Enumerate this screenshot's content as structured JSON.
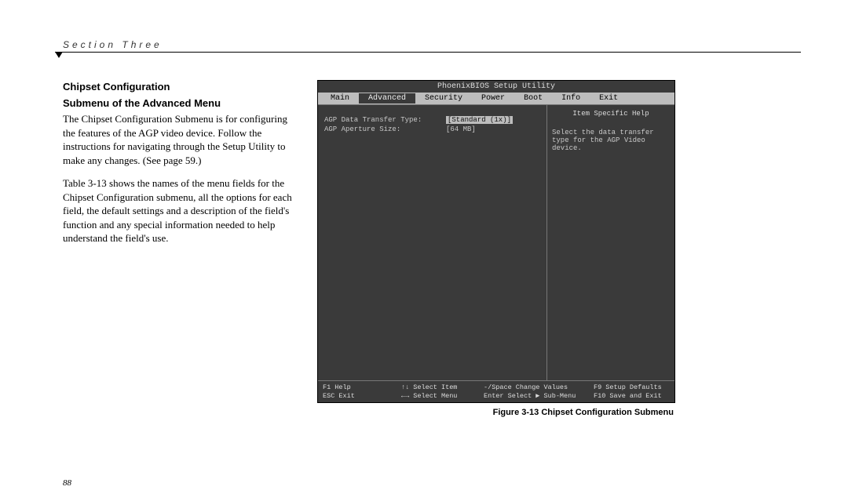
{
  "header": {
    "section": "Section Three"
  },
  "text": {
    "heading1": "Chipset Configuration",
    "heading2": "Submenu of the Advanced Menu",
    "p1": "The Chipset Configuration Submenu is for configuring the features of the AGP video device. Follow the instructions for navigating through the Setup Utility to make any changes. (See page 59.)",
    "p2": "Table 3-13 shows the names of the menu fields for the Chipset Configuration submenu, all the options for each field, the default settings and a description of the field's function and any special information needed to help understand the field's use."
  },
  "bios": {
    "title": "PhoenixBIOS Setup Utility",
    "menu": [
      "Main",
      "Advanced",
      "Security",
      "Power",
      "Boot",
      "Info",
      "Exit"
    ],
    "active_menu": 1,
    "rows": [
      {
        "label": "AGP Data Transfer Type:",
        "value": "[Standard (1x)]",
        "selected": true
      },
      {
        "label": "AGP Aperture Size:",
        "value": "[64 MB]",
        "selected": false
      }
    ],
    "help_title": "Item Specific Help",
    "help_text": "Select the data transfer type for the AGP Video device.",
    "foot": {
      "a1": "F1  Help",
      "a2": "↑↓ Select Item",
      "a3": "-/Space Change Values",
      "a4": "F9  Setup Defaults",
      "b1": "ESC Exit",
      "b2": "←→ Select Menu",
      "b3": "Enter Select ▶ Sub-Menu",
      "b4": "F10 Save and Exit"
    }
  },
  "caption": "Figure 3-13 Chipset Configuration Submenu",
  "pagenum": "88"
}
